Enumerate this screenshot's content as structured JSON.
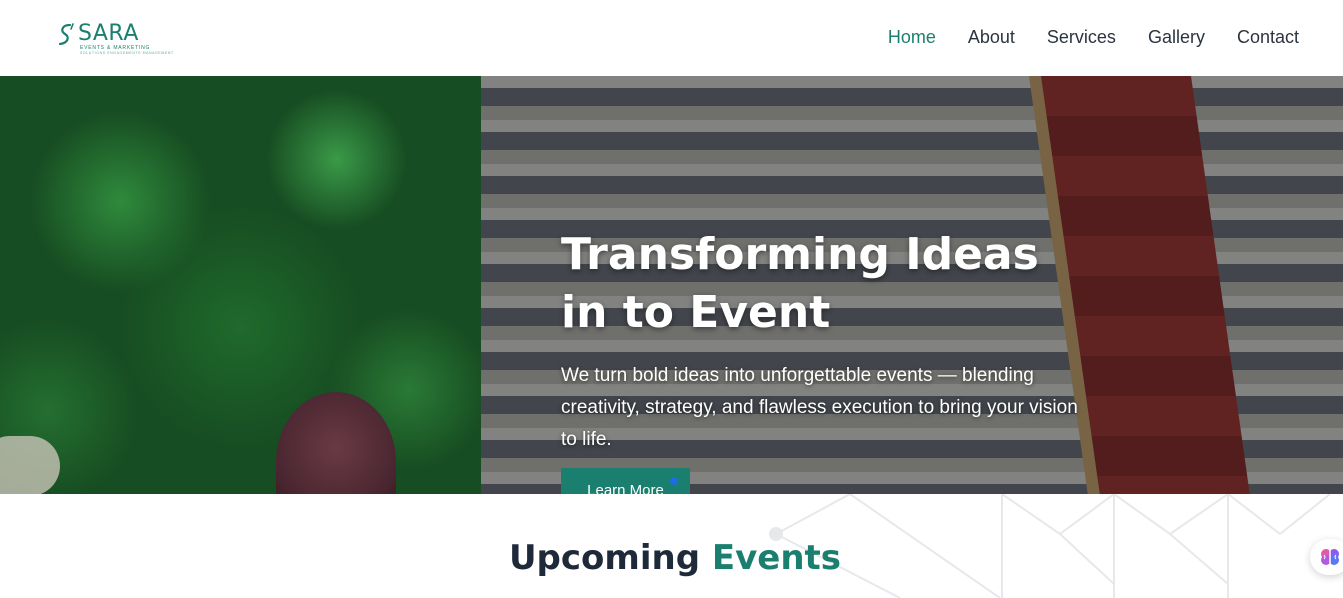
{
  "brand": {
    "name": "SARA",
    "tagline": "EVENTS & MARKETING",
    "subline": "SOLUTIONS ENGAGEMENTS MANAGEMENT",
    "color": "#1a7f6f"
  },
  "nav": {
    "items": [
      {
        "label": "Home",
        "active": true
      },
      {
        "label": "About",
        "active": false
      },
      {
        "label": "Services",
        "active": false
      },
      {
        "label": "Gallery",
        "active": false
      },
      {
        "label": "Contact",
        "active": false
      }
    ]
  },
  "hero": {
    "title": "Transforming Ideas in to Event",
    "text": "We turn bold ideas into unforgettable events — blending creativity, strategy, and flawless execution to bring your vision to life.",
    "button": "Learn More"
  },
  "events": {
    "title_main": "Upcoming",
    "title_accent": "Events"
  },
  "icons": {
    "logo": "sara-logo-icon",
    "fab": "brain-icon"
  },
  "colors": {
    "accent": "#1a7f6f",
    "heading": "#1e2a3a",
    "nav_text": "#2b3440",
    "carousel_dot": "#1a6fe0"
  }
}
